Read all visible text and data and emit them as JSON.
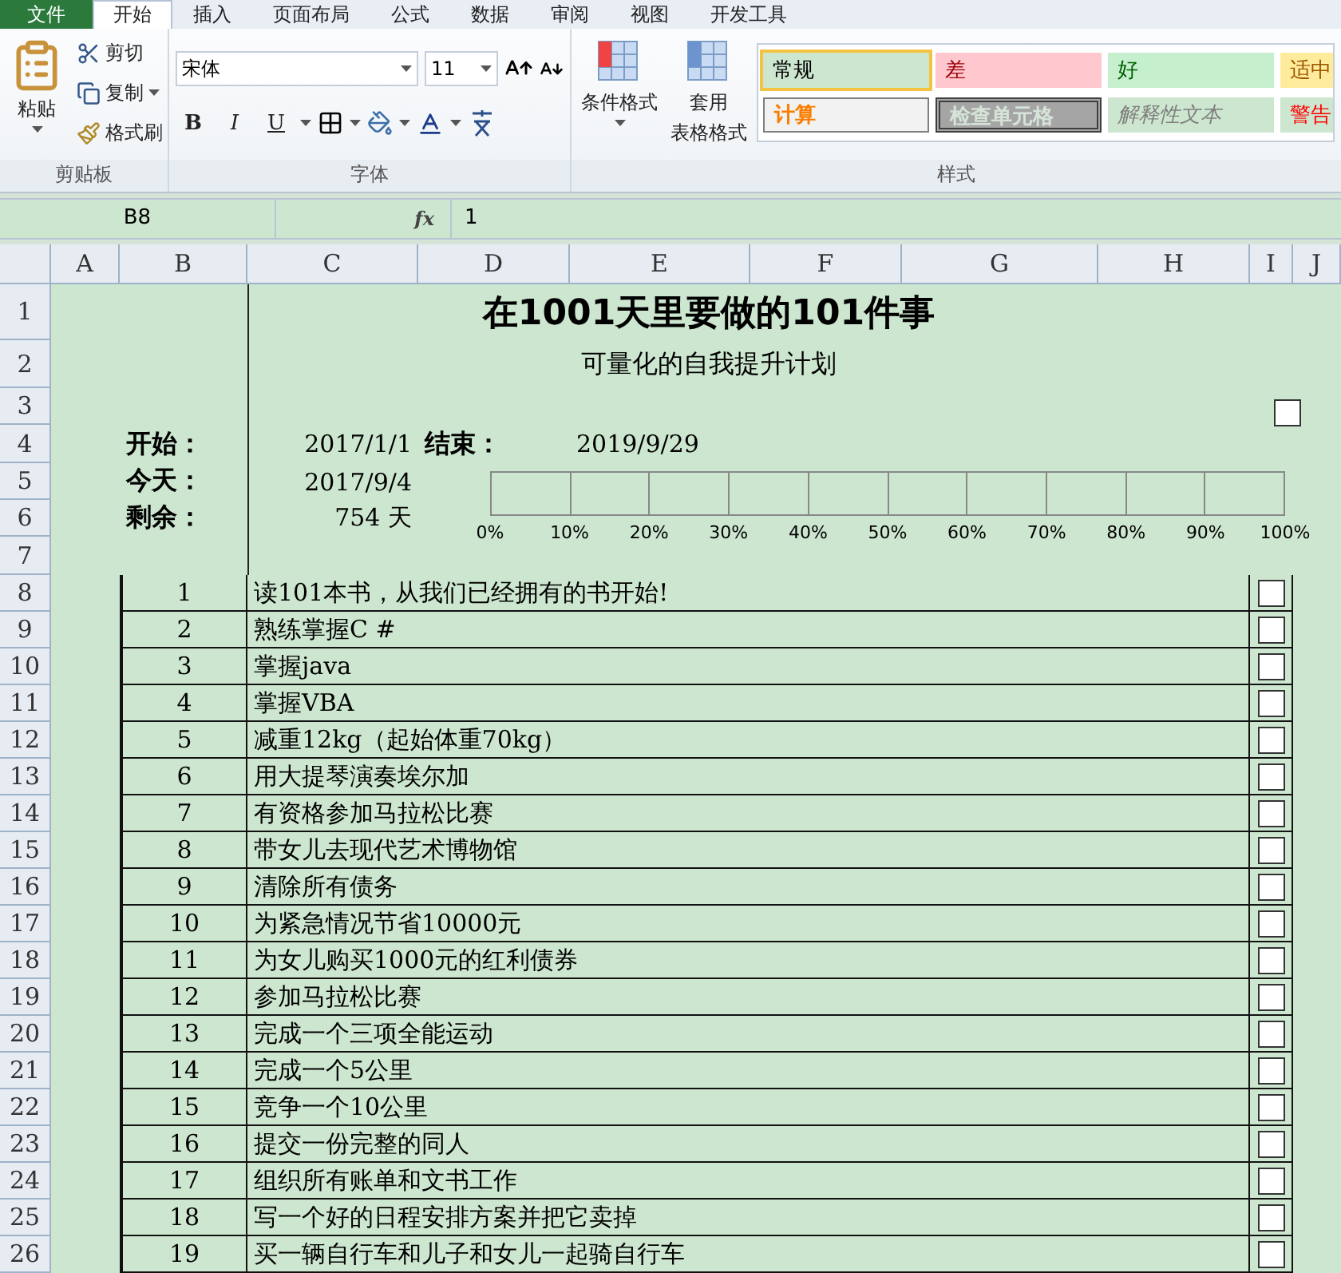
{
  "file_tab": {
    "label": "文件"
  },
  "tabs": [
    {
      "label": "开始",
      "selected": true
    },
    {
      "label": "插入",
      "selected": false
    },
    {
      "label": "页面布局",
      "selected": false
    },
    {
      "label": "公式",
      "selected": false
    },
    {
      "label": "数据",
      "selected": false
    },
    {
      "label": "审阅",
      "selected": false
    },
    {
      "label": "视图",
      "selected": false
    },
    {
      "label": "开发工具",
      "selected": false
    }
  ],
  "clipboard": {
    "label": "剪贴板",
    "paste": "粘贴",
    "cut": "剪切",
    "copy": "复制",
    "format_painter": "格式刷"
  },
  "font": {
    "label": "字体",
    "font_name": "宋体",
    "font_size": "11",
    "bold": "B",
    "italic": "I",
    "underline": "U"
  },
  "styles": {
    "label": "样式",
    "conditional": "条件格式",
    "table_format": [
      "套用",
      "表格格式"
    ],
    "gallery": [
      {
        "label": "常规",
        "kind": "normal",
        "selected": true
      },
      {
        "label": "差",
        "kind": "bad",
        "selected": false
      },
      {
        "label": "好",
        "kind": "good",
        "selected": false
      },
      {
        "label": "适中",
        "kind": "neutral",
        "selected": false
      },
      {
        "label": "计算",
        "kind": "calc",
        "selected": false
      },
      {
        "label": "检查单元格",
        "kind": "check",
        "selected": false
      },
      {
        "label": "解释性文本",
        "kind": "explanatory",
        "selected": false
      },
      {
        "label": "警告",
        "kind": "warning",
        "selected": false
      }
    ]
  },
  "formula_bar": {
    "name_box": "B8",
    "function_label": "fx",
    "value": "1"
  },
  "sheet": {
    "columns": [
      "A",
      "B",
      "C",
      "D",
      "E",
      "F",
      "G",
      "H",
      "I",
      "J"
    ],
    "row_numbers": [
      "1",
      "2",
      "3",
      "4",
      "5",
      "6",
      "7",
      "8",
      "9",
      "10",
      "11",
      "12",
      "13",
      "14",
      "15",
      "16",
      "17",
      "18",
      "19",
      "20",
      "21",
      "22",
      "23",
      "24",
      "25",
      "26"
    ],
    "title": "在1001天里要做的101件事",
    "subtitle": "可量化的自我提升计划",
    "header_checkbox": {
      "checked": false
    },
    "start_label": "开始：",
    "start_value": "2017/1/1",
    "end_label": "结束：",
    "end_value": "2019/9/29",
    "today_label": "今天：",
    "today_value": "2017/9/4",
    "remaining_label": "剩余：",
    "remaining_value": "754 天",
    "progress": {
      "ticks": [
        "0%",
        "10%",
        "20%",
        "30%",
        "40%",
        "50%",
        "60%",
        "70%",
        "80%",
        "90%",
        "100%"
      ]
    },
    "items": [
      {
        "number": "1",
        "text": "读101本书，从我们已经拥有的书开始!",
        "checked": false
      },
      {
        "number": "2",
        "text": "熟练掌握C #",
        "checked": false
      },
      {
        "number": "3",
        "text": "掌握java",
        "checked": false
      },
      {
        "number": "4",
        "text": "掌握VBA",
        "checked": false
      },
      {
        "number": "5",
        "text": "减重12kg（起始体重70kg）",
        "checked": false
      },
      {
        "number": "6",
        "text": "用大提琴演奏埃尔加",
        "checked": false
      },
      {
        "number": "7",
        "text": "有资格参加马拉松比赛",
        "checked": false
      },
      {
        "number": "8",
        "text": "带女儿去现代艺术博物馆",
        "checked": false
      },
      {
        "number": "9",
        "text": "清除所有债务",
        "checked": false
      },
      {
        "number": "10",
        "text": "为紧急情况节省10000元",
        "checked": false
      },
      {
        "number": "11",
        "text": "为女儿购买1000元的红利债券",
        "checked": false
      },
      {
        "number": "12",
        "text": "参加马拉松比赛",
        "checked": false
      },
      {
        "number": "13",
        "text": "完成一个三项全能运动",
        "checked": false
      },
      {
        "number": "14",
        "text": "完成一个5公里",
        "checked": false
      },
      {
        "number": "15",
        "text": "竞争一个10公里",
        "checked": false
      },
      {
        "number": "16",
        "text": "提交一份完整的同人",
        "checked": false
      },
      {
        "number": "17",
        "text": "组织所有账单和文书工作",
        "checked": false
      },
      {
        "number": "18",
        "text": "写一个好的日程安排方案并把它卖掉",
        "checked": false
      },
      {
        "number": "19",
        "text": "买一辆自行车和儿子和女儿一起骑自行车",
        "checked": false
      }
    ]
  }
}
